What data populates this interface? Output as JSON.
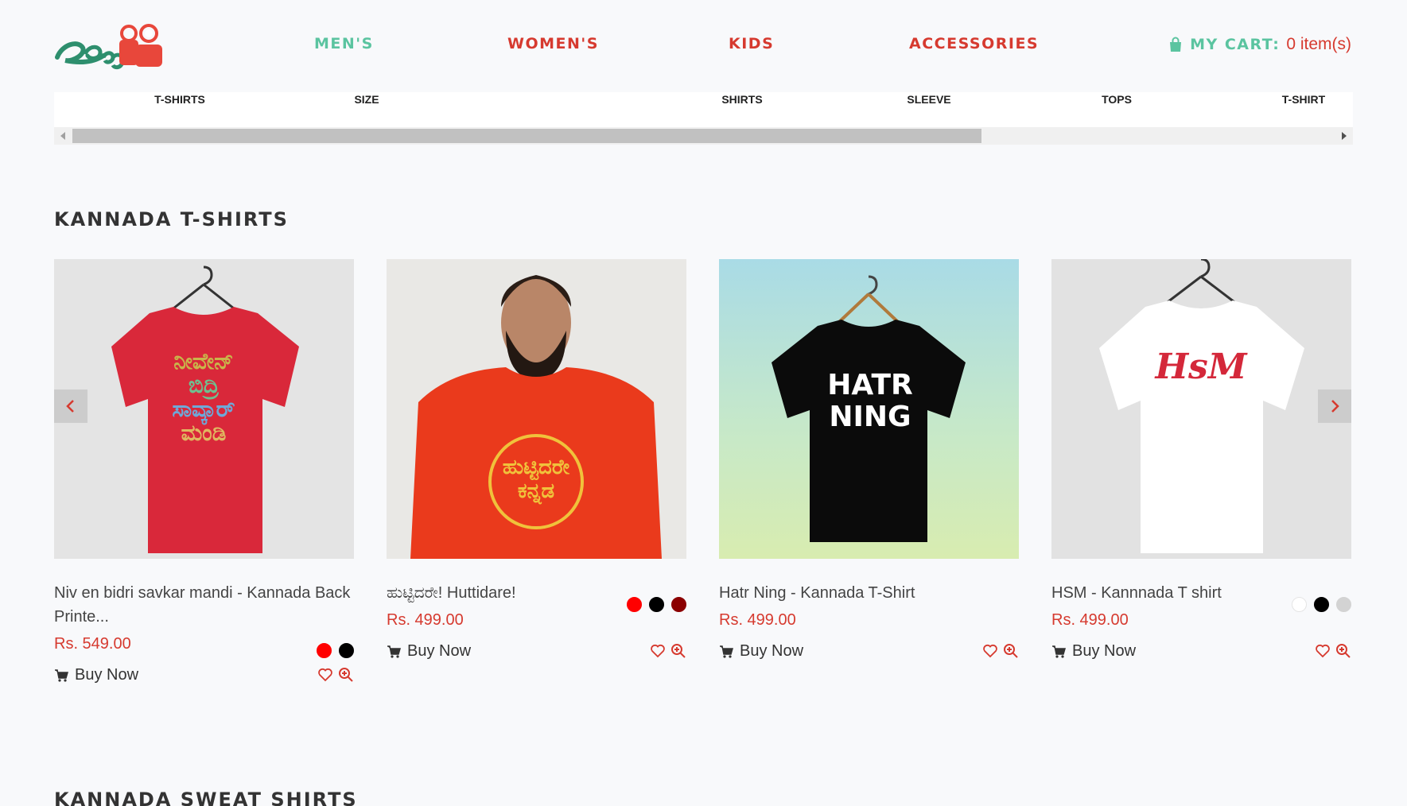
{
  "header": {
    "logo_alt": "logo",
    "nav": [
      {
        "label": "MEN'S"
      },
      {
        "label": "WOMEN'S"
      },
      {
        "label": "KIDS"
      },
      {
        "label": "ACCESSORIES"
      }
    ],
    "cart_label": "MY CART:",
    "cart_count": "0 item(s)"
  },
  "category_strip": {
    "items": [
      "T-SHIRTS",
      "SIZE",
      "SHIRTS",
      "SLEEVE",
      "TOPS",
      "T-SHIRT"
    ],
    "scroll_fraction": 0.72
  },
  "sections": {
    "first_title": "KANNADA T-SHIRTS",
    "second_title": "KANNADA SWEAT SHIRTS"
  },
  "products": [
    {
      "name": "Niv en bidri savkar mandi - Kannada Back Printe...",
      "price": "Rs. 549.00",
      "buy": "Buy Now",
      "colors": [
        "#ff0000",
        "#000000"
      ],
      "image": {
        "shirt_color": "#d9283a",
        "bg": "#e4e4e4",
        "print": "ನೀವೇನ್ ಬಿದ್ರಿ ಸಾವ್ಕಾರ್ ಮಂಡಿ"
      }
    },
    {
      "name": "ಹುಟ್ಟಿದರೇ! Huttidare!",
      "price": "Rs. 499.00",
      "buy": "Buy Now",
      "colors": [
        "#ff0000",
        "#000000",
        "#8b0000"
      ],
      "image": {
        "shirt_color": "#ea3a1c",
        "bg": "#e9e8e5",
        "print": "ಹುಟ್ಟಿದರೇ ಕನ್ನಡ"
      }
    },
    {
      "name": "Hatr Ning - Kannada T-Shirt",
      "price": "Rs. 499.00",
      "buy": "Buy Now",
      "colors": [],
      "image": {
        "shirt_color": "#0b0b0b",
        "bg": "#b9e2da",
        "print": "HATR NING"
      }
    },
    {
      "name": "HSM - Kannnada T shirt",
      "price": "Rs. 499.00",
      "buy": "Buy Now",
      "colors": [
        "#ffffff",
        "#000000",
        "#d3d3d3"
      ],
      "image": {
        "shirt_color": "#ffffff",
        "bg": "#e2e2e2",
        "print": "HsM"
      }
    }
  ],
  "icons": {
    "cart_icon": "shopping-bag-icon",
    "buy_icon": "cart-icon",
    "wish_icon": "heart-icon",
    "zoom_icon": "zoom-in-icon",
    "prev": "chevron-left-icon",
    "next": "chevron-right-icon"
  },
  "colors": {
    "accent_green": "#5bc4a0",
    "accent_red": "#d63a2f"
  }
}
